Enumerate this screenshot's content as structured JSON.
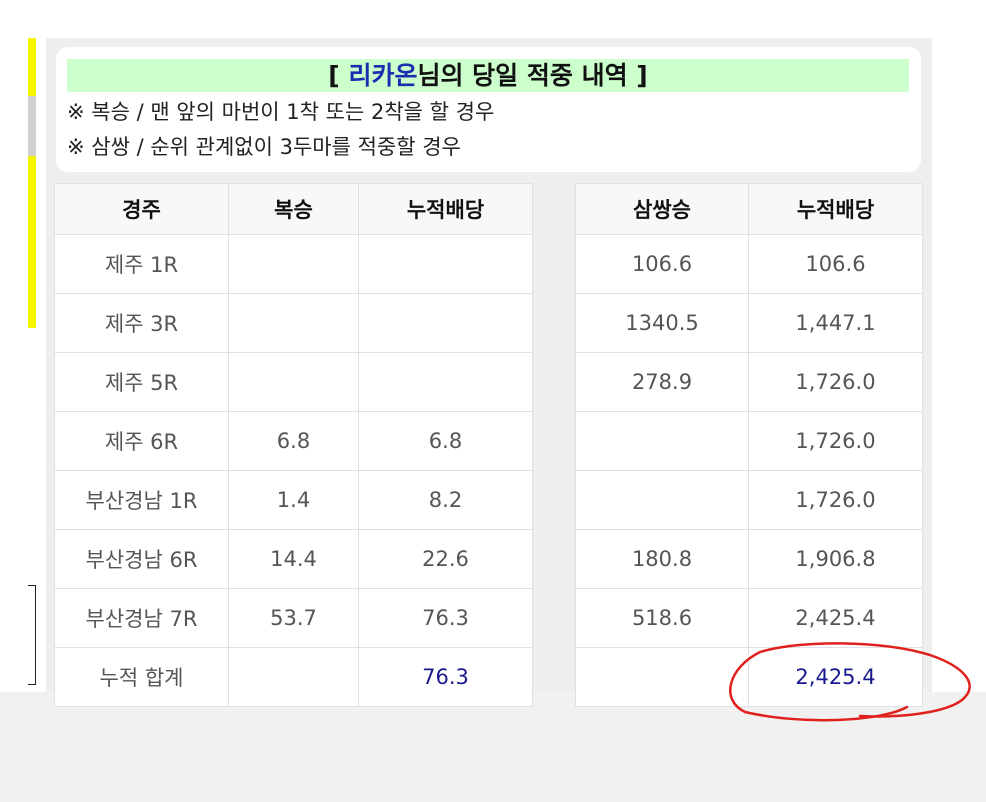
{
  "notice": {
    "title_open": "[ ",
    "user_name": "리카온",
    "title_rest": "님의 당일 적중 내역 ]",
    "note_boksung": "※ 복승 / 맨 앞의 마번이 1착 또는 2착을 할 경우",
    "note_samssang": "※ 삼쌍 / 순위 관계없이 3두마를 적중할 경우"
  },
  "left_table": {
    "headers": [
      "경주",
      "복승",
      "누적배당"
    ],
    "rows": [
      [
        "제주 1R",
        "",
        ""
      ],
      [
        "제주 3R",
        "",
        ""
      ],
      [
        "제주 5R",
        "",
        ""
      ],
      [
        "제주 6R",
        "6.8",
        "6.8"
      ],
      [
        "부산경남 1R",
        "1.4",
        "8.2"
      ],
      [
        "부산경남 6R",
        "14.4",
        "22.6"
      ],
      [
        "부산경남 7R",
        "53.7",
        "76.3"
      ],
      [
        "누적 합계",
        "",
        "76.3"
      ]
    ]
  },
  "right_table": {
    "headers": [
      "삼쌍승",
      "누적배당"
    ],
    "rows": [
      [
        "106.6",
        "106.6"
      ],
      [
        "1340.5",
        "1,447.1"
      ],
      [
        "278.9",
        "1,726.0"
      ],
      [
        "",
        "1,726.0"
      ],
      [
        "",
        "1,726.0"
      ],
      [
        "180.8",
        "1,906.8"
      ],
      [
        "518.6",
        "2,425.4"
      ],
      [
        "",
        "2,425.4"
      ]
    ]
  },
  "annotation": {
    "color": "#e0201c"
  },
  "colors": {
    "highlight": "#ccffcc",
    "name": "#1a2fb0",
    "total": "#1a1a8f",
    "side_marker": "#f5f500"
  }
}
